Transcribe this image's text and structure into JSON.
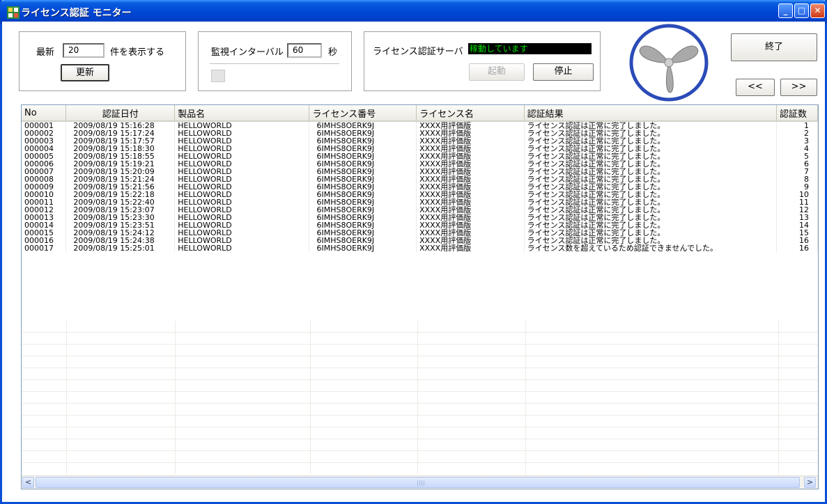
{
  "window": {
    "title": "ライセンス認証 モニター",
    "min_glyph": "_",
    "max_glyph": "□",
    "close_glyph": "✕"
  },
  "display_panel": {
    "prefix_label": "最新",
    "count_value": "20",
    "suffix_label": "件を表示する",
    "refresh_button": "更新"
  },
  "interval_panel": {
    "label": "監視インターバル",
    "value": "60",
    "unit": "秒"
  },
  "server_panel": {
    "label": "ライセンス認証サーバ",
    "status": "稼動しています",
    "start_button": "起動",
    "stop_button": "停止"
  },
  "toolbar": {
    "exit_button": "終了",
    "prev_button": "<<",
    "next_button": ">>"
  },
  "table": {
    "columns": [
      "No",
      "認証日付",
      "製品名",
      "ライセンス番号",
      "ライセンス名",
      "認証結果",
      "認証数"
    ],
    "rows": [
      [
        "000001",
        "2009/08/19 15:16:28",
        "HELLOWORLD",
        "6IMHS8OERK9J",
        "XXXX用評価版",
        "ライセンス認証は正常に完了しました。",
        "1"
      ],
      [
        "000002",
        "2009/08/19 15:17:24",
        "HELLOWORLD",
        "6IMHS8OERK9J",
        "XXXX用評価版",
        "ライセンス認証は正常に完了しました。",
        "2"
      ],
      [
        "000003",
        "2009/08/19 15:17:57",
        "HELLOWORLD",
        "6IMHS8OERK9J",
        "XXXX用評価版",
        "ライセンス認証は正常に完了しました。",
        "3"
      ],
      [
        "000004",
        "2009/08/19 15:18:30",
        "HELLOWORLD",
        "6IMHS8OERK9J",
        "XXXX用評価版",
        "ライセンス認証は正常に完了しました。",
        "4"
      ],
      [
        "000005",
        "2009/08/19 15:18:55",
        "HELLOWORLD",
        "6IMHS8OERK9J",
        "XXXX用評価版",
        "ライセンス認証は正常に完了しました。",
        "5"
      ],
      [
        "000006",
        "2009/08/19 15:19:21",
        "HELLOWORLD",
        "6IMHS8OERK9J",
        "XXXX用評価版",
        "ライセンス認証は正常に完了しました。",
        "6"
      ],
      [
        "000007",
        "2009/08/19 15:20:09",
        "HELLOWORLD",
        "6IMHS8OERK9J",
        "XXXX用評価版",
        "ライセンス認証は正常に完了しました。",
        "7"
      ],
      [
        "000008",
        "2009/08/19 15:21:24",
        "HELLOWORLD",
        "6IMHS8OERK9J",
        "XXXX用評価版",
        "ライセンス認証は正常に完了しました。",
        "8"
      ],
      [
        "000009",
        "2009/08/19 15:21:56",
        "HELLOWORLD",
        "6IMHS8OERK9J",
        "XXXX用評価版",
        "ライセンス認証は正常に完了しました。",
        "9"
      ],
      [
        "000010",
        "2009/08/19 15:22:18",
        "HELLOWORLD",
        "6IMHS8OERK9J",
        "XXXX用評価版",
        "ライセンス認証は正常に完了しました。",
        "10"
      ],
      [
        "000011",
        "2009/08/19 15:22:40",
        "HELLOWORLD",
        "6IMHS8OERK9J",
        "XXXX用評価版",
        "ライセンス認証は正常に完了しました。",
        "11"
      ],
      [
        "000012",
        "2009/08/19 15:23:07",
        "HELLOWORLD",
        "6IMHS8OERK9J",
        "XXXX用評価版",
        "ライセンス認証は正常に完了しました。",
        "12"
      ],
      [
        "000013",
        "2009/08/19 15:23:30",
        "HELLOWORLD",
        "6IMHS8OERK9J",
        "XXXX用評価版",
        "ライセンス認証は正常に完了しました。",
        "13"
      ],
      [
        "000014",
        "2009/08/19 15:23:51",
        "HELLOWORLD",
        "6IMHS8OERK9J",
        "XXXX用評価版",
        "ライセンス認証は正常に完了しました。",
        "14"
      ],
      [
        "000015",
        "2009/08/19 15:24:12",
        "HELLOWORLD",
        "6IMHS8OERK9J",
        "XXXX用評価版",
        "ライセンス認証は正常に完了しました。",
        "15"
      ],
      [
        "000016",
        "2009/08/19 15:24:38",
        "HELLOWORLD",
        "6IMHS8OERK9J",
        "XXXX用評価版",
        "ライセンス認証は正常に完了しました。",
        "16"
      ],
      [
        "000017",
        "2009/08/19 15:25:01",
        "HELLOWORLD",
        "6IMHS8OERK9J",
        "XXXX用評価版",
        "ライセンス数を超えているため認証できませんでした。",
        "16"
      ]
    ]
  },
  "scrollbar": {
    "left_glyph": "<",
    "right_glyph": ">"
  },
  "colors": {
    "titlebar": "#0046d5",
    "status_bg": "#000000",
    "status_text": "#00e000"
  }
}
